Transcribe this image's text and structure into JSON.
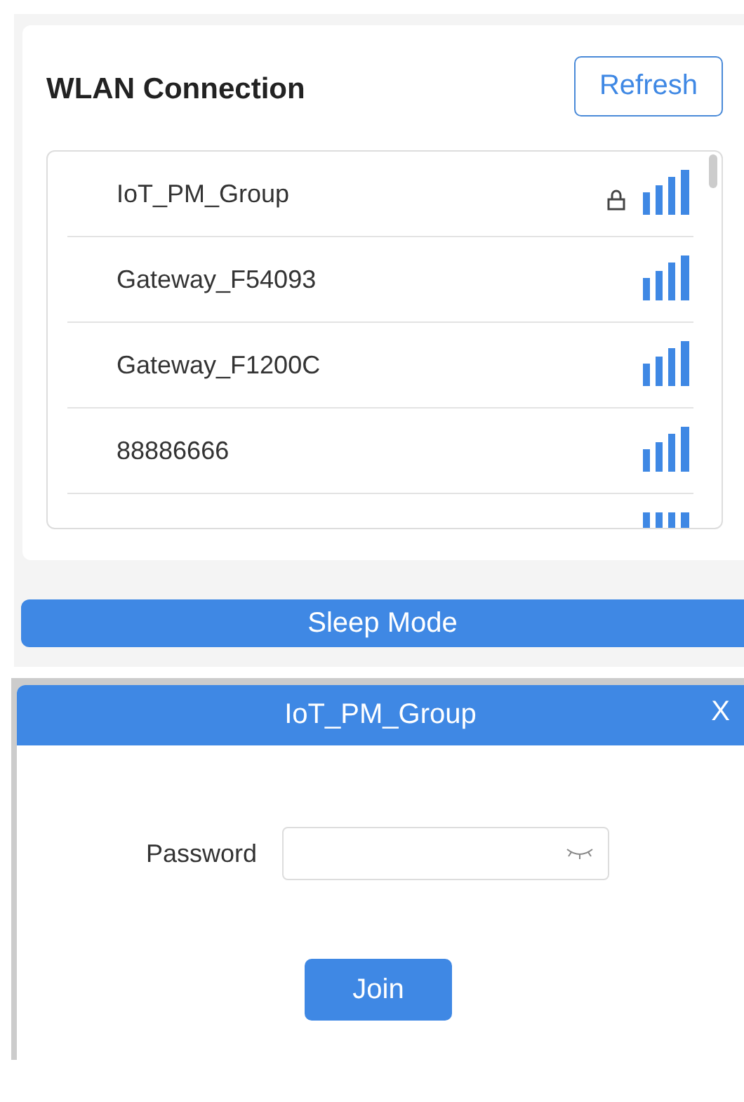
{
  "wlan": {
    "title": "WLAN Connection",
    "refresh": "Refresh",
    "networks": [
      {
        "name": "IoT_PM_Group",
        "locked": true
      },
      {
        "name": "Gateway_F54093",
        "locked": false
      },
      {
        "name": "Gateway_F1200C",
        "locked": false
      },
      {
        "name": "88886666",
        "locked": false
      },
      {
        "locked": false
      }
    ]
  },
  "sleep_button": "Sleep Mode",
  "dialog": {
    "title": "IoT_PM_Group",
    "close": "X",
    "password_label": "Password",
    "join": "Join"
  }
}
